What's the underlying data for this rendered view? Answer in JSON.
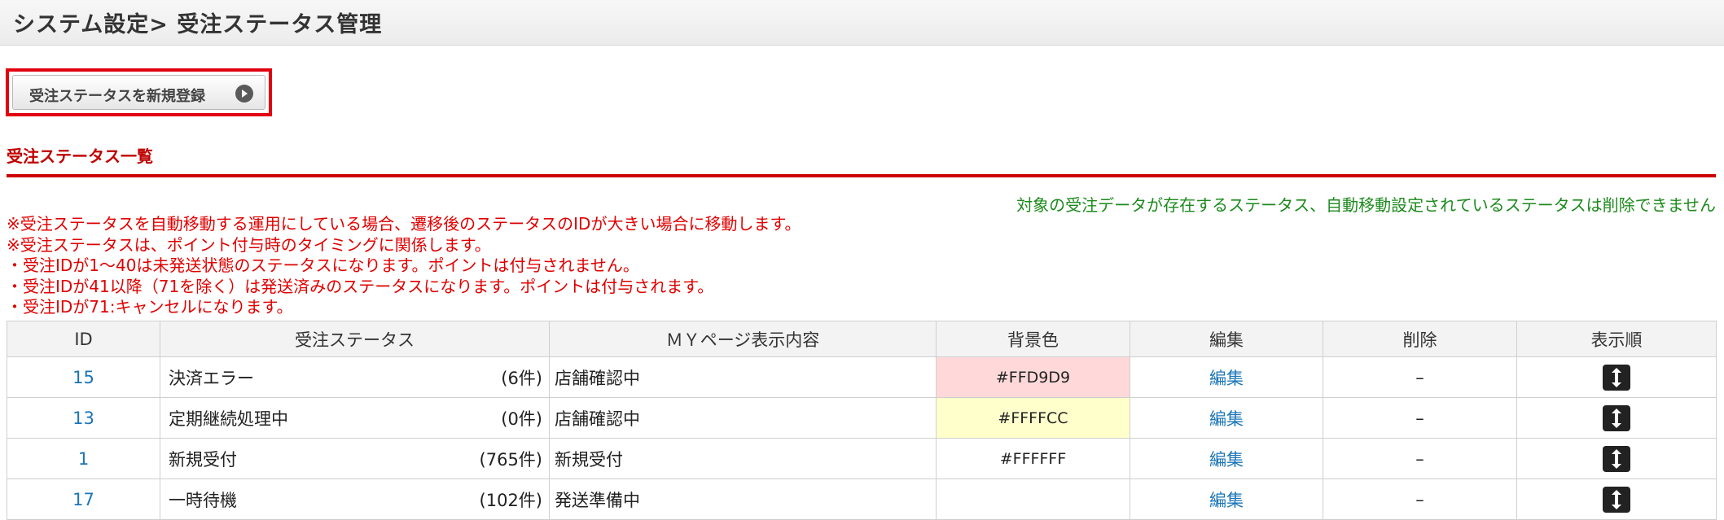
{
  "header": {
    "title": "システム設定> 受注ステータス管理"
  },
  "toolbar": {
    "register_label": "受注ステータスを新規登録"
  },
  "section": {
    "heading": "受注ステータス一覧"
  },
  "notice": {
    "delete_restriction": "対象の受注データが存在するステータス、自動移動設定されているステータスは削除できません"
  },
  "notes": [
    "※受注ステータスを自動移動する運用にしている場合、遷移後のステータスのIDが大きい場合に移動します。",
    "※受注ステータスは、ポイント付与時のタイミングに関係します。",
    "・受注IDが1〜40は未発送状態のステータスになります。ポイントは付与されません。",
    "・受注IDが41以降（71を除く）は発送済みのステータスになります。ポイントは付与されます。",
    "・受注IDが71:キャンセルになります。"
  ],
  "table": {
    "columns": [
      "ID",
      "受注ステータス",
      "ＭＹページ表示内容",
      "背景色",
      "編集",
      "削除",
      "表示順"
    ],
    "rows": [
      {
        "id": "15",
        "name": "決済エラー",
        "count": "(6件)",
        "mypage": "店舗確認中",
        "bg": "#FFD9D9",
        "edit": "編集",
        "delete": "–"
      },
      {
        "id": "13",
        "name": "定期継続処理中",
        "count": "(0件)",
        "mypage": "店舗確認中",
        "bg": "#FFFFCC",
        "edit": "編集",
        "delete": "–"
      },
      {
        "id": "1",
        "name": "新規受付",
        "count": "(765件)",
        "mypage": "新規受付",
        "bg": "#FFFFFF",
        "edit": "編集",
        "delete": "–"
      },
      {
        "id": "17",
        "name": "一時待機",
        "count": "(102件)",
        "mypage": "発送準備中",
        "bg": "",
        "edit": "編集",
        "delete": "–"
      }
    ]
  },
  "icons": {
    "register_arrow": "arrow-right-circle-icon",
    "order_handle": "up-down-arrow-icon"
  }
}
